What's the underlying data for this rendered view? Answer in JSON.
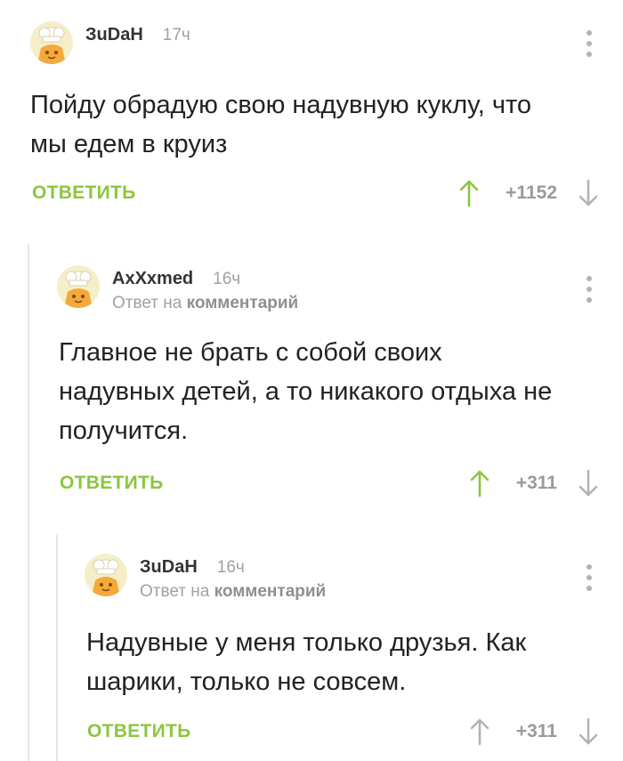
{
  "comments": [
    {
      "username": "ЗuDaH",
      "time": "17ч",
      "text_lines": [
        "Пойду обрадую свою надувную куклу, что",
        "мы едем в круиз"
      ],
      "reply_label": "ОТВЕТИТЬ",
      "rating": "+1152",
      "upvote_color": "#8cc63e"
    },
    {
      "username": "AxXxmed",
      "time": "16ч",
      "reply_prefix": "Ответ на",
      "reply_target": "комментарий",
      "text_lines": [
        "Главное не брать с собой своих",
        "надувных детей, а то никакого отдыха не",
        "получится."
      ],
      "reply_label": "ОТВЕТИТЬ",
      "rating": "+311",
      "upvote_color": "#8cc63e"
    },
    {
      "username": "ЗuDaH",
      "time": "16ч",
      "reply_prefix": "Ответ на",
      "reply_target": "комментарий",
      "text_lines": [
        "Надувные у меня только друзья. Как",
        "шарики, только не совсем."
      ],
      "reply_label": "ОТВЕТИТЬ",
      "rating": "+311",
      "upvote_color": "#b3b3b3"
    }
  ],
  "colors": {
    "accent_green": "#8cc63e",
    "muted_gray": "#a0a0a0",
    "thread_line": "#e6e6e6"
  },
  "icons": {
    "avatar": "chef-avatar-icon",
    "more": "more-vertical-icon",
    "upvote": "arrow-up-icon",
    "downvote": "arrow-down-icon"
  }
}
